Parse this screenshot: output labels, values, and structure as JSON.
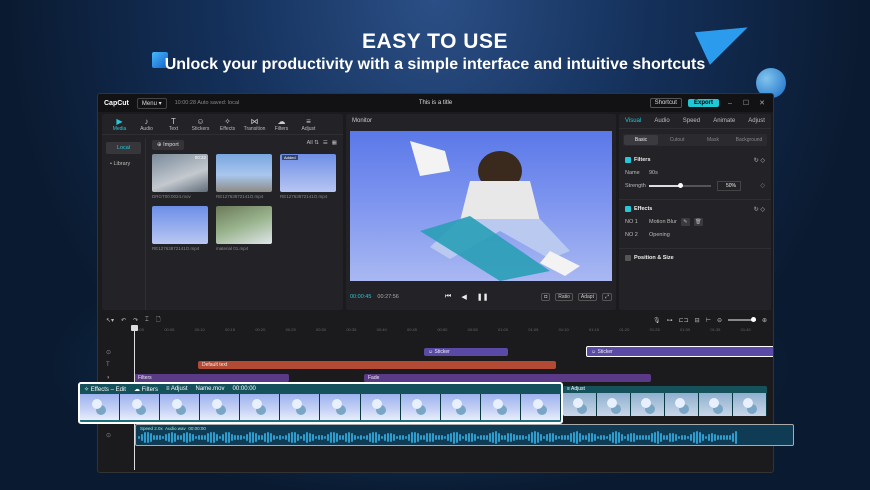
{
  "headline": {
    "title": "EASY TO USE",
    "subtitle": "Unlock your productivity with a simple interface and intuitive shortcuts"
  },
  "titlebar": {
    "app_name": "CapCut",
    "menu_label": "Menu",
    "autosave": "10:00:28 Auto saved: local",
    "project_title": "This is a title",
    "shortcut_label": "Shortcut",
    "export_label": "Export",
    "min": "–",
    "max": "☐",
    "close": "✕"
  },
  "media": {
    "tabs": [
      {
        "icon": "▶",
        "label": "Media"
      },
      {
        "icon": "♪",
        "label": "Audio"
      },
      {
        "icon": "T",
        "label": "Text"
      },
      {
        "icon": "☺",
        "label": "Stickers"
      },
      {
        "icon": "✧",
        "label": "Effects"
      },
      {
        "icon": "⋈",
        "label": "Transition"
      },
      {
        "icon": "☁",
        "label": "Filters"
      },
      {
        "icon": "≡",
        "label": "Adjust"
      }
    ],
    "nav": {
      "local": "Local",
      "library": "• Library"
    },
    "import_label": "Import",
    "filter_label": "All",
    "items": [
      {
        "name": "DRGT00:0024.mov",
        "duration": "00:22",
        "badge": ""
      },
      {
        "name": "RE12763872141O.mp4",
        "duration": "",
        "badge": ""
      },
      {
        "name": "RE12763872141O.mp4",
        "duration": "",
        "badge": "Added"
      },
      {
        "name": "RE12763872141O.mp4",
        "duration": "",
        "badge": ""
      },
      {
        "name": "material 01.mp4",
        "duration": "",
        "badge": ""
      }
    ]
  },
  "monitor": {
    "title": "Monitor",
    "current_time": "00:00:45",
    "total_time": "00:27:56",
    "ratio_label": "Ratio",
    "adapt_label": "Adapt"
  },
  "inspector": {
    "tabs": [
      "Visual",
      "Audio",
      "Speed",
      "Animate",
      "Adjust"
    ],
    "subtabs": [
      "Basic",
      "Cutout",
      "Mask",
      "Background"
    ],
    "filters": {
      "title": "Filters",
      "name_key": "Name",
      "name_value": "90s",
      "strength_key": "Strength",
      "strength_value": "50%",
      "strength_fraction": 0.5
    },
    "effects": {
      "title": "Effects",
      "no1_key": "NO 1",
      "no1_value": "Motion Blur",
      "no2_key": "NO 2",
      "no2_value": "Opening"
    },
    "position": {
      "title": "Position & Size"
    }
  },
  "timeline": {
    "ruler": [
      "00:00",
      "00:05",
      "00:10",
      "00:15",
      "00:20",
      "00:25",
      "00:30",
      "00:35",
      "00:40",
      "00:45",
      "00:50",
      "00:55",
      "01:00",
      "01:05",
      "01:10",
      "01:15",
      "01:20",
      "01:25",
      "01:30",
      "01:35",
      "01:40"
    ],
    "sticker_label": "Sticker",
    "text_label": "Default text",
    "filters_label": "Filters",
    "fade_label": "Fade",
    "main_clip": {
      "effects": "Effects – Edit",
      "filters": "Filters",
      "adjust": "Adjust",
      "name": "Name.mov",
      "time": "00:00:00"
    },
    "second_clip": {
      "label": "Adjust"
    },
    "audio": {
      "speed": "Speed 2.0x",
      "name": "Audio.wav",
      "time": "00:00:00"
    }
  },
  "colors": {
    "accent": "#25c7d9",
    "sticker": "#5a4aa6",
    "text": "#b24a34",
    "filters": "#5a3a86",
    "clip": "#1f6f7a"
  }
}
